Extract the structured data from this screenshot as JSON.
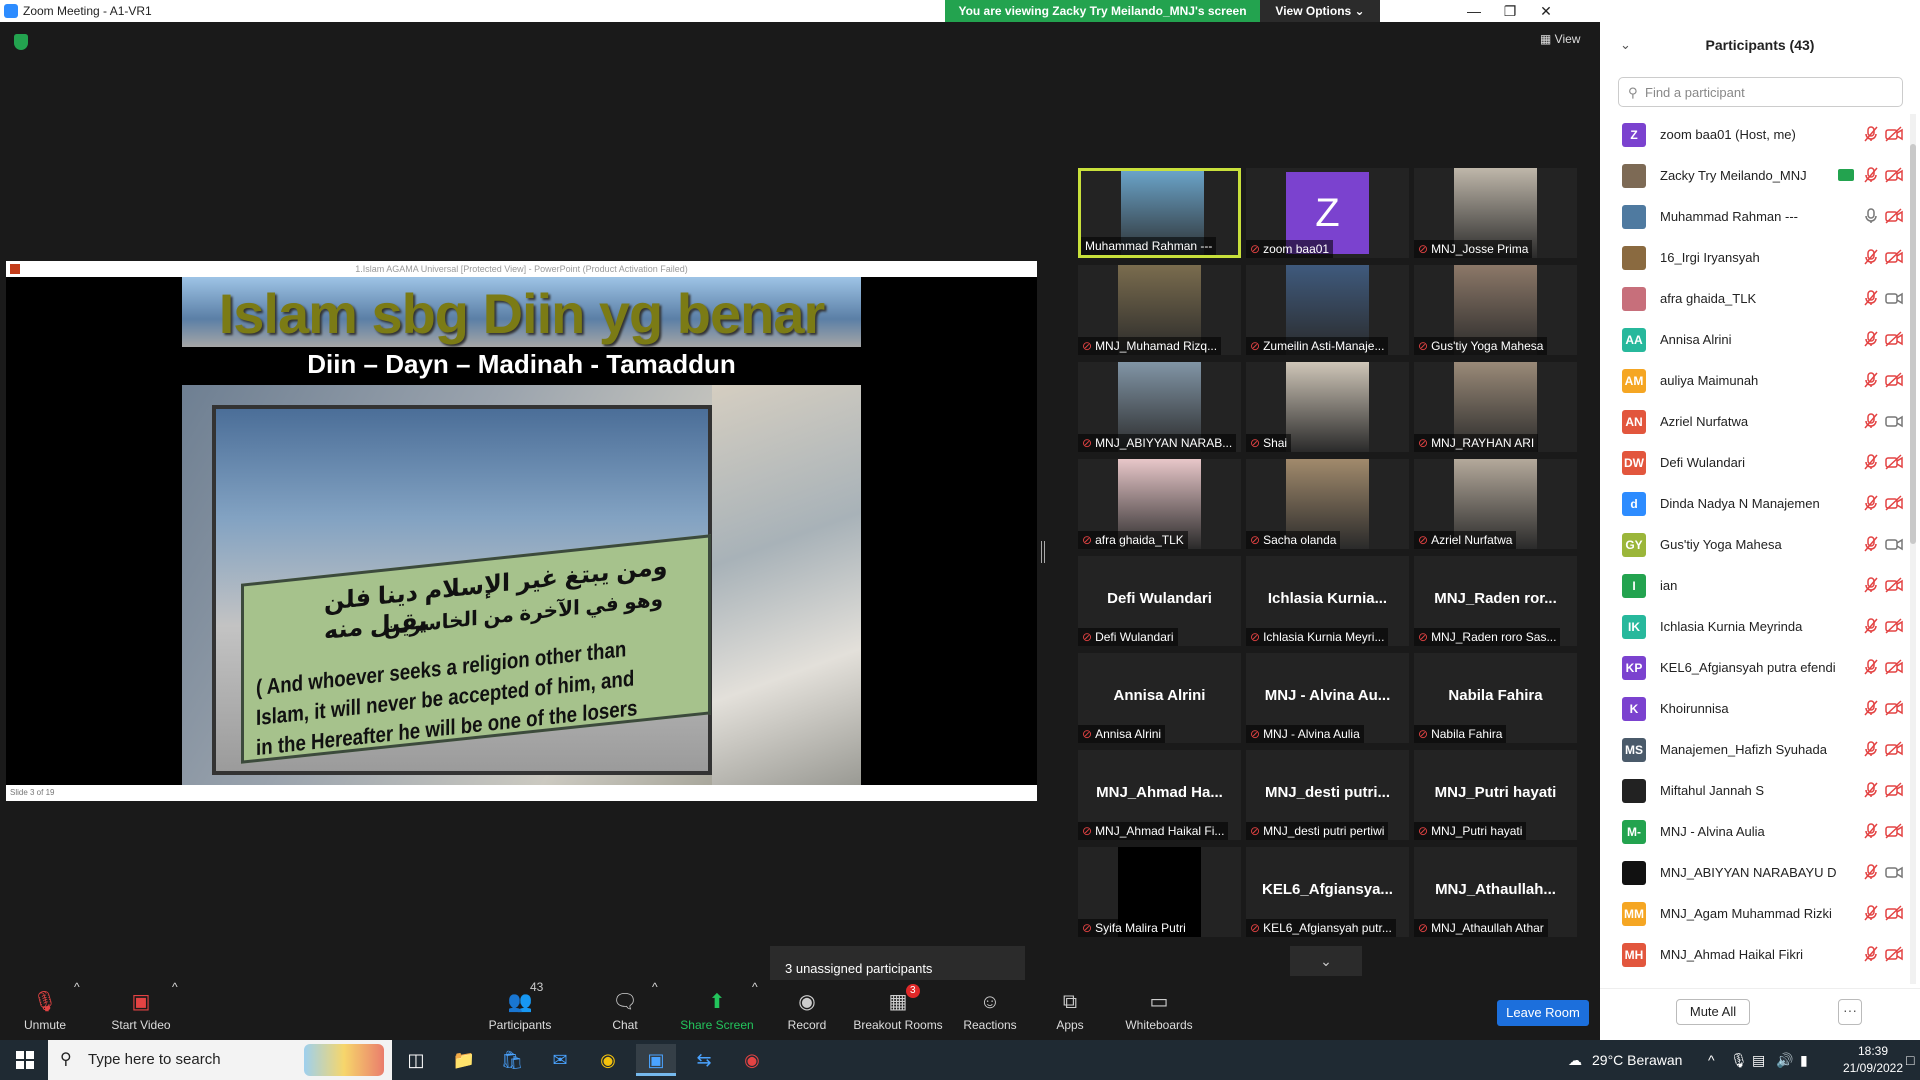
{
  "window": {
    "title": "Zoom Meeting - A1-VR1"
  },
  "banner": {
    "viewing_text": "You are viewing Zacky Try Meilando_MNJ's screen",
    "view_options": "View Options ⌄"
  },
  "view_button": "View",
  "share": {
    "ppt_title": "1.Islam AGAMA Universal [Protected View] - PowerPoint (Product Activation Failed)",
    "slide_heading": "Islam sbg Diin yg benar",
    "slide_sub": "Diin – Dayn – Madinah - Tamaddun",
    "sign_arabic": "ومن يبتغ غير الإسلام دينا فلن يقبل منه",
    "sign_arabic2": "وهو في الآخرة من الخاسرين",
    "sign_english": "( And whoever seeks a religion other than Islam, it will never be accepted of him, and in the Hereafter he will be one of the losers",
    "status": "Slide 3 of 19"
  },
  "gallery": [
    {
      "name": "Muhammad Rahman ---",
      "muted": false,
      "video": true,
      "active": true,
      "color": "#6aa3c8"
    },
    {
      "name": "zoom baa01",
      "muted": true,
      "video": false,
      "letter": "Z"
    },
    {
      "name": "MNJ_Josse Prima",
      "muted": true,
      "video": true,
      "color": "#bfb7aa"
    },
    {
      "name": "MNJ_Muhamad Rizq...",
      "muted": true,
      "video": true,
      "color": "#7a6c4e"
    },
    {
      "name": "Zumeilin Asti-Manaje...",
      "muted": true,
      "video": true,
      "color": "#3f5a7d"
    },
    {
      "name": "Gus'tiy Yoga Mahesa",
      "muted": true,
      "video": true,
      "color": "#8c7868"
    },
    {
      "name": "MNJ_ABIYYAN NARAB...",
      "muted": true,
      "video": true,
      "color": "#8195a6"
    },
    {
      "name": "Shai",
      "muted": true,
      "video": true,
      "color": "#cfc6b8"
    },
    {
      "name": "MNJ_RAYHAN ARI",
      "muted": true,
      "video": true,
      "color": "#9a8a78"
    },
    {
      "name": "afra ghaida_TLK",
      "muted": true,
      "video": true,
      "color": "#e8c7c9"
    },
    {
      "name": "Sacha olanda",
      "muted": true,
      "video": true,
      "color": "#a18a6c"
    },
    {
      "name": "Azriel Nurfatwa",
      "muted": true,
      "video": true,
      "color": "#b4a99b"
    },
    {
      "name": "Defi Wulandari",
      "muted": true,
      "video": false,
      "big": "Defi Wulandari"
    },
    {
      "name": "Ichlasia Kurnia Meyri...",
      "muted": true,
      "video": false,
      "big": "Ichlasia Kurnia..."
    },
    {
      "name": "MNJ_Raden roro Sas...",
      "muted": true,
      "video": false,
      "big": "MNJ_Raden ror..."
    },
    {
      "name": "Annisa Alrini",
      "muted": true,
      "video": false,
      "big": "Annisa Alrini"
    },
    {
      "name": "MNJ - Alvina Aulia",
      "muted": true,
      "video": false,
      "big": "MNJ - Alvina Au..."
    },
    {
      "name": "Nabila Fahira",
      "muted": true,
      "video": false,
      "big": "Nabila Fahira"
    },
    {
      "name": "MNJ_Ahmad Haikal Fi...",
      "muted": true,
      "video": false,
      "big": "MNJ_Ahmad Ha..."
    },
    {
      "name": "MNJ_desti putri pertiwi",
      "muted": true,
      "video": false,
      "big": "MNJ_desti putri..."
    },
    {
      "name": "MNJ_Putri hayati",
      "muted": true,
      "video": false,
      "big": "MNJ_Putri hayati"
    },
    {
      "name": "Syifa Malira Putri",
      "muted": true,
      "video": true,
      "color": "#000000"
    },
    {
      "name": "KEL6_Afgiansyah putr...",
      "muted": true,
      "video": false,
      "big": "KEL6_Afgiansya..."
    },
    {
      "name": "MNJ_Athaullah Athar",
      "muted": true,
      "video": false,
      "big": "MNJ_Athaullah..."
    }
  ],
  "unassigned": "3 unassigned participants",
  "toolbar": {
    "unmute": "Unmute",
    "start_video": "Start Video",
    "participants": "Participants",
    "participants_count": "43",
    "chat": "Chat",
    "share_screen": "Share Screen",
    "record": "Record",
    "breakout": "Breakout Rooms",
    "breakout_count": "3",
    "reactions": "Reactions",
    "apps": "Apps",
    "whiteboards": "Whiteboards",
    "leave": "Leave Room"
  },
  "panel": {
    "title": "Participants (43)",
    "search_placeholder": "Find a participant",
    "mute_all": "Mute All",
    "more": "···"
  },
  "participants": [
    {
      "name": "zoom baa01 (Host, me)",
      "initials": "Z",
      "color": "#7b42cf",
      "mic": "muted",
      "cam": "off"
    },
    {
      "name": "Zacky Try Meilando_MNJ",
      "initials": "",
      "color": "#7d6a55",
      "mic": "muted",
      "cam": "off",
      "sharing": true
    },
    {
      "name": "Muhammad Rahman ---",
      "initials": "",
      "color": "#4f7aa0",
      "mic": "on",
      "cam": "off"
    },
    {
      "name": "16_Irgi Iryansyah",
      "initials": "",
      "color": "#8a6a40",
      "mic": "muted",
      "cam": "off"
    },
    {
      "name": "afra ghaida_TLK",
      "initials": "",
      "color": "#c76f7b",
      "mic": "muted",
      "cam": "on"
    },
    {
      "name": "Annisa Alrini",
      "initials": "AA",
      "color": "#27b89c",
      "mic": "muted",
      "cam": "off"
    },
    {
      "name": "auliya Maimunah",
      "initials": "AM",
      "color": "#f5a623",
      "mic": "muted",
      "cam": "off"
    },
    {
      "name": "Azriel Nurfatwa",
      "initials": "AN",
      "color": "#e2563d",
      "mic": "muted",
      "cam": "on"
    },
    {
      "name": "Defi Wulandari",
      "initials": "DW",
      "color": "#e2563d",
      "mic": "muted",
      "cam": "off"
    },
    {
      "name": "Dinda Nadya N Manajemen",
      "initials": "d",
      "color": "#2d8cff",
      "mic": "muted",
      "cam": "off"
    },
    {
      "name": "Gus'tiy Yoga Mahesa",
      "initials": "GY",
      "color": "#9bb63a",
      "mic": "muted",
      "cam": "on"
    },
    {
      "name": "ian",
      "initials": "I",
      "color": "#23a34f",
      "mic": "muted",
      "cam": "off"
    },
    {
      "name": "Ichlasia Kurnia Meyrinda",
      "initials": "IK",
      "color": "#27b89c",
      "mic": "muted",
      "cam": "off"
    },
    {
      "name": "KEL6_Afgiansyah putra efendi",
      "initials": "KP",
      "color": "#7b42cf",
      "mic": "muted",
      "cam": "off"
    },
    {
      "name": "Khoirunnisa",
      "initials": "K",
      "color": "#7b42cf",
      "mic": "muted",
      "cam": "off"
    },
    {
      "name": "Manajemen_Hafizh Syuhada",
      "initials": "MS",
      "color": "#4a5a6a",
      "mic": "muted",
      "cam": "off"
    },
    {
      "name": "Miftahul Jannah S",
      "initials": "",
      "color": "#222222",
      "mic": "muted",
      "cam": "off"
    },
    {
      "name": "MNJ - Alvina Aulia",
      "initials": "M-",
      "color": "#23a34f",
      "mic": "muted",
      "cam": "off"
    },
    {
      "name": "MNJ_ABIYYAN NARABAYU D",
      "initials": "",
      "color": "#111111",
      "mic": "muted",
      "cam": "on"
    },
    {
      "name": "MNJ_Agam Muhammad Rizki",
      "initials": "MM",
      "color": "#f5a623",
      "mic": "muted",
      "cam": "off"
    },
    {
      "name": "MNJ_Ahmad Haikal Fikri",
      "initials": "MH",
      "color": "#e2563d",
      "mic": "muted",
      "cam": "off"
    }
  ],
  "taskbar": {
    "search_placeholder": "Type here to search",
    "weather": "29°C  Berawan",
    "time": "18:39",
    "date": "21/09/2022"
  }
}
